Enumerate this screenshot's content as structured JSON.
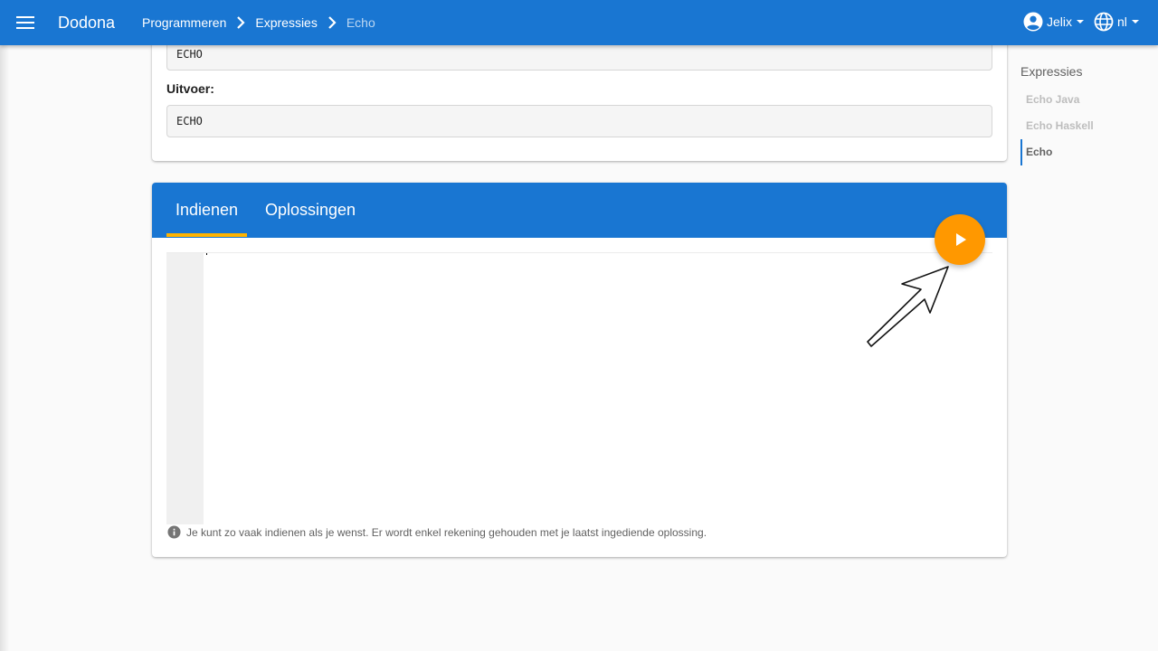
{
  "app": {
    "brand": "Dodona"
  },
  "breadcrumb": {
    "items": [
      "Programmeren",
      "Expressies",
      "Echo"
    ]
  },
  "header": {
    "user_name": "Jelix",
    "language": "nl"
  },
  "sample": {
    "input_value": "ECHO",
    "output_label": "Uitvoer:",
    "output_value": "ECHO"
  },
  "submission": {
    "tabs": [
      {
        "label": "Indienen"
      },
      {
        "label": "Oplossingen"
      }
    ],
    "hint": "Je kunt zo vaak indienen als je wenst. Er wordt enkel rekening gehouden met je laatst ingediende oplossing."
  },
  "sidenav": {
    "title": "Expressies",
    "items": [
      {
        "label": "Echo Java"
      },
      {
        "label": "Echo Haskell"
      },
      {
        "label": "Echo"
      }
    ]
  },
  "colors": {
    "primary": "#1976d2",
    "accent": "#ff9800",
    "tab_indicator": "#ffb300"
  },
  "icons": {
    "menu": "menu-icon",
    "breadcrumb_separator": "chevron-right-icon",
    "user": "account-circle-icon",
    "language": "globe-icon",
    "run": "play-icon",
    "info": "info-icon"
  }
}
